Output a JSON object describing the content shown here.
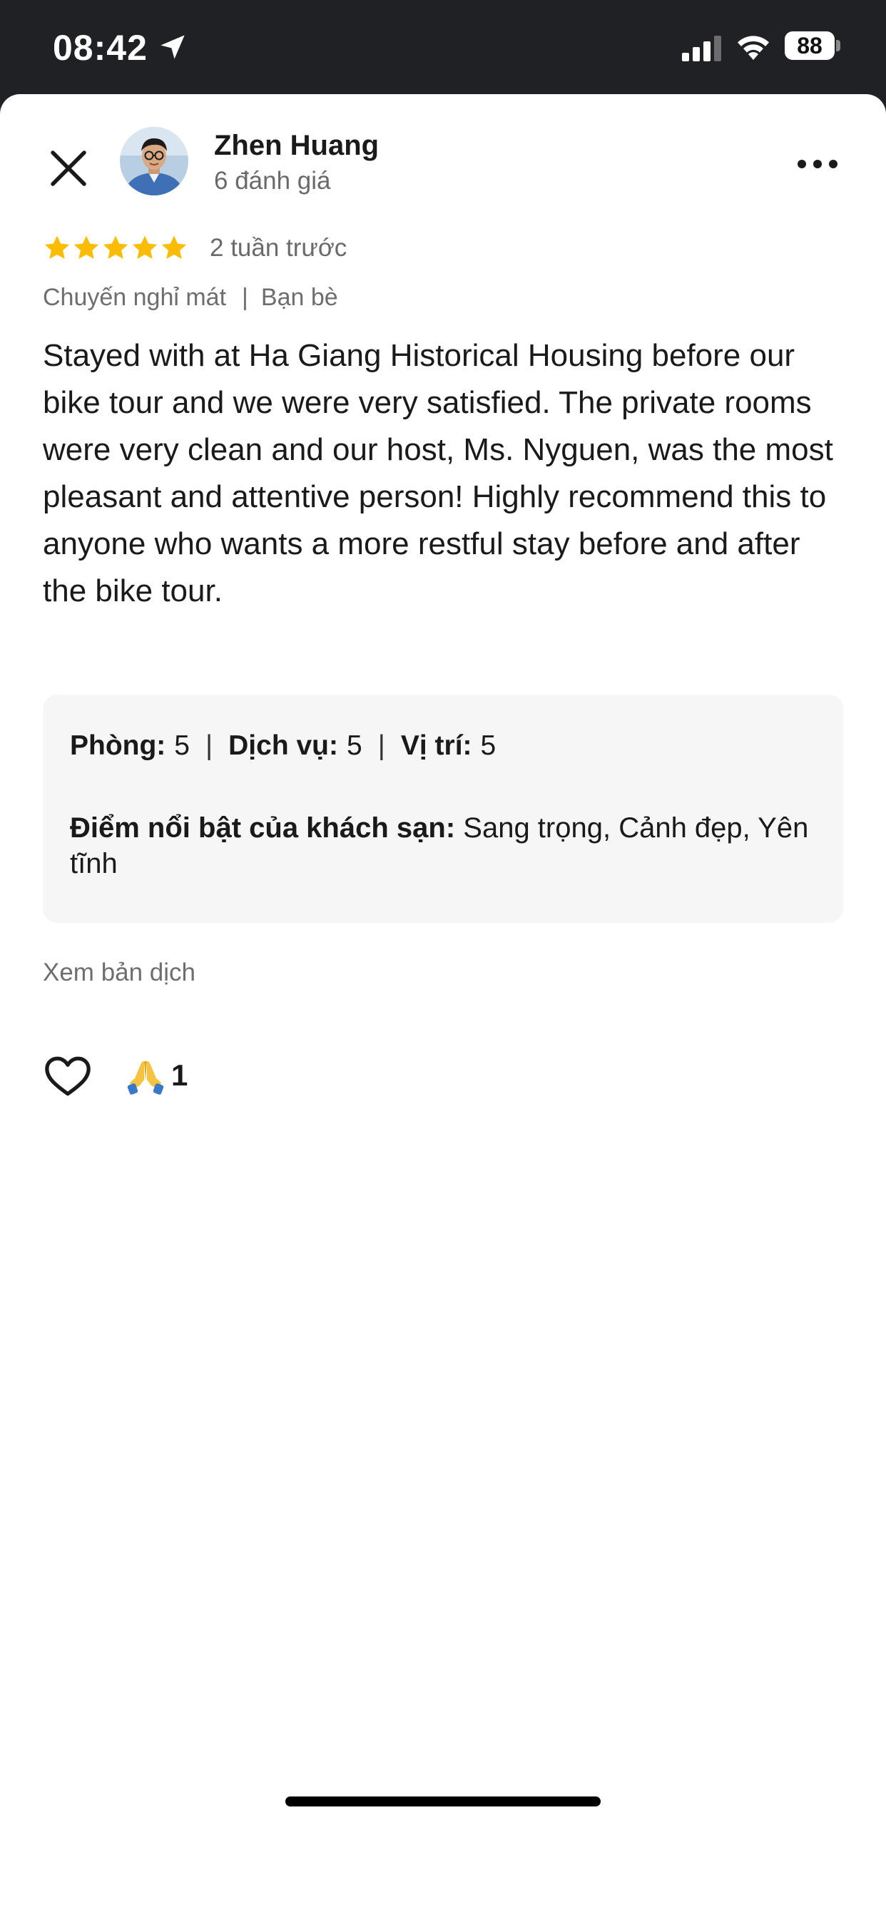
{
  "status_bar": {
    "time": "08:42",
    "battery": "88",
    "icons": [
      "location-arrow-icon",
      "signal-icon",
      "wifi-icon",
      "battery-icon"
    ]
  },
  "review": {
    "reviewer_name": "Zhen Huang",
    "review_count": "6 đánh giá",
    "rating": 5,
    "rating_max": 5,
    "date": "2 tuần trước",
    "trip_type": "Chuyến nghỉ mát",
    "traveler_type": "Bạn bè",
    "text": "Stayed with at Ha Giang Historical Housing before our bike tour and we were very satisfied. The private rooms were very clean and our host, Ms. Nyguen, was the most pleasant and attentive person! Highly recommend this to anyone who wants a more restful stay before and after the bike tour.",
    "scores": {
      "room_label": "Phòng:",
      "room_value": "5",
      "service_label": "Dịch vụ:",
      "service_value": "5",
      "location_label": "Vị trí:",
      "location_value": "5"
    },
    "highlights_label": "Điểm nổi bật của khách sạn:",
    "highlights_value": "Sang trọng, Cảnh đẹp, Yên tĩnh",
    "translate_link": "Xem bản dịch",
    "reaction_count": "1"
  },
  "colors": {
    "star": "#FBBC04",
    "status_bar_bg": "#202125",
    "secondary_text": "#6e6e6e",
    "scores_bg": "#f6f6f6"
  }
}
